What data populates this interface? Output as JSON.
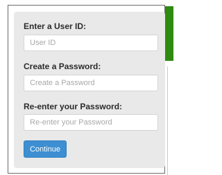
{
  "form": {
    "user_id": {
      "label": "Enter a User ID:",
      "placeholder": "User ID",
      "value": ""
    },
    "password": {
      "label": "Create a Password:",
      "placeholder": "Create a Password",
      "value": ""
    },
    "password_confirm": {
      "label": "Re-enter your Password:",
      "placeholder": "Re-enter your Password",
      "value": ""
    },
    "continue_label": "Continue"
  },
  "colors": {
    "accent": "#2e8b0f",
    "button": "#3d8fd1",
    "card_background": "#e9e9e9"
  }
}
